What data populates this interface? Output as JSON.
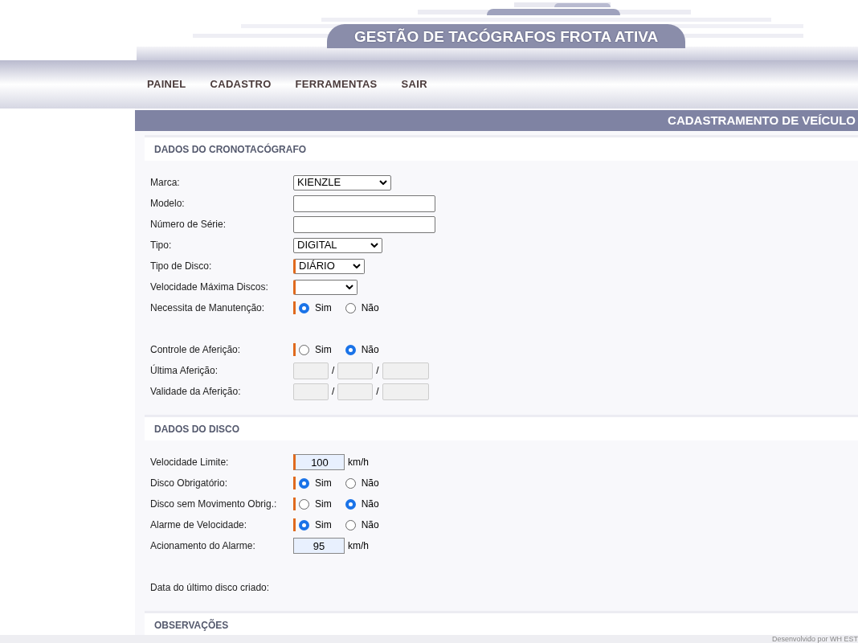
{
  "header": {
    "title": "GESTÃO DE TACÓGRAFOS FROTA ATIVA"
  },
  "nav": [
    "PAINEL",
    "CADASTRO",
    "FERRAMENTAS",
    "SAIR"
  ],
  "page_title": "CADASTRAMENTO DE VEÍCULO",
  "sections": [
    {
      "title": "DADOS DO CRONOTACÓGRAFO",
      "fields": [
        {
          "kind": "select",
          "label": "Marca:",
          "value": "KIENZLE",
          "required": false
        },
        {
          "kind": "text",
          "label": "Modelo:",
          "required": false
        },
        {
          "kind": "text",
          "label": "Número de Série:",
          "required": false
        },
        {
          "kind": "select",
          "label": "Tipo:",
          "value": "DIGITAL",
          "required": false
        },
        {
          "kind": "select",
          "label": "Tipo de Disco:",
          "value": "DIÁRIO",
          "required": true
        },
        {
          "kind": "select",
          "label": "Velocidade Máxima Discos:",
          "required": true
        },
        {
          "kind": "radio",
          "label": "Necessita de Manutenção:",
          "required": true,
          "options": [
            {
              "label": "Sim",
              "selected": true
            },
            {
              "label": "Não",
              "selected": false
            }
          ]
        },
        {
          "kind": "radio",
          "label": "Controle de Aferição:",
          "required": true,
          "spaced": true,
          "options": [
            {
              "label": "Sim",
              "selected": false
            },
            {
              "label": "Não",
              "selected": true
            }
          ]
        },
        {
          "kind": "date",
          "label": "Última Aferição:",
          "required": false,
          "disabled": true,
          "separators": [
            "/",
            "/"
          ]
        },
        {
          "kind": "date",
          "label": "Validade da Aferição:",
          "required": false,
          "disabled": true,
          "separators": [
            "/",
            "/"
          ]
        }
      ]
    },
    {
      "title": "DADOS DO DISCO",
      "fields": [
        {
          "kind": "number",
          "label": "Velocidade Limite:",
          "value": "100",
          "unit": "km/h",
          "required": true
        },
        {
          "kind": "radio",
          "label": "Disco Obrigatório:",
          "required": true,
          "options": [
            {
              "label": "Sim",
              "selected": true
            },
            {
              "label": "Não",
              "selected": false
            }
          ]
        },
        {
          "kind": "radio",
          "label": "Disco sem Movimento Obrig.:",
          "required": true,
          "options": [
            {
              "label": "Sim",
              "selected": false
            },
            {
              "label": "Não",
              "selected": true
            }
          ]
        },
        {
          "kind": "radio",
          "label": "Alarme de Velocidade:",
          "required": true,
          "options": [
            {
              "label": "Sim",
              "selected": true
            },
            {
              "label": "Não",
              "selected": false
            }
          ]
        },
        {
          "kind": "number",
          "label": "Acionamento do Alarme:",
          "value": "95",
          "unit": "km/h",
          "required": false
        },
        {
          "kind": "static",
          "label": "Data do último disco criado:",
          "spaced": true
        }
      ]
    },
    {
      "title": "OBSERVAÇÕES"
    }
  ],
  "footer": "Desenvolvido por WH EST"
}
